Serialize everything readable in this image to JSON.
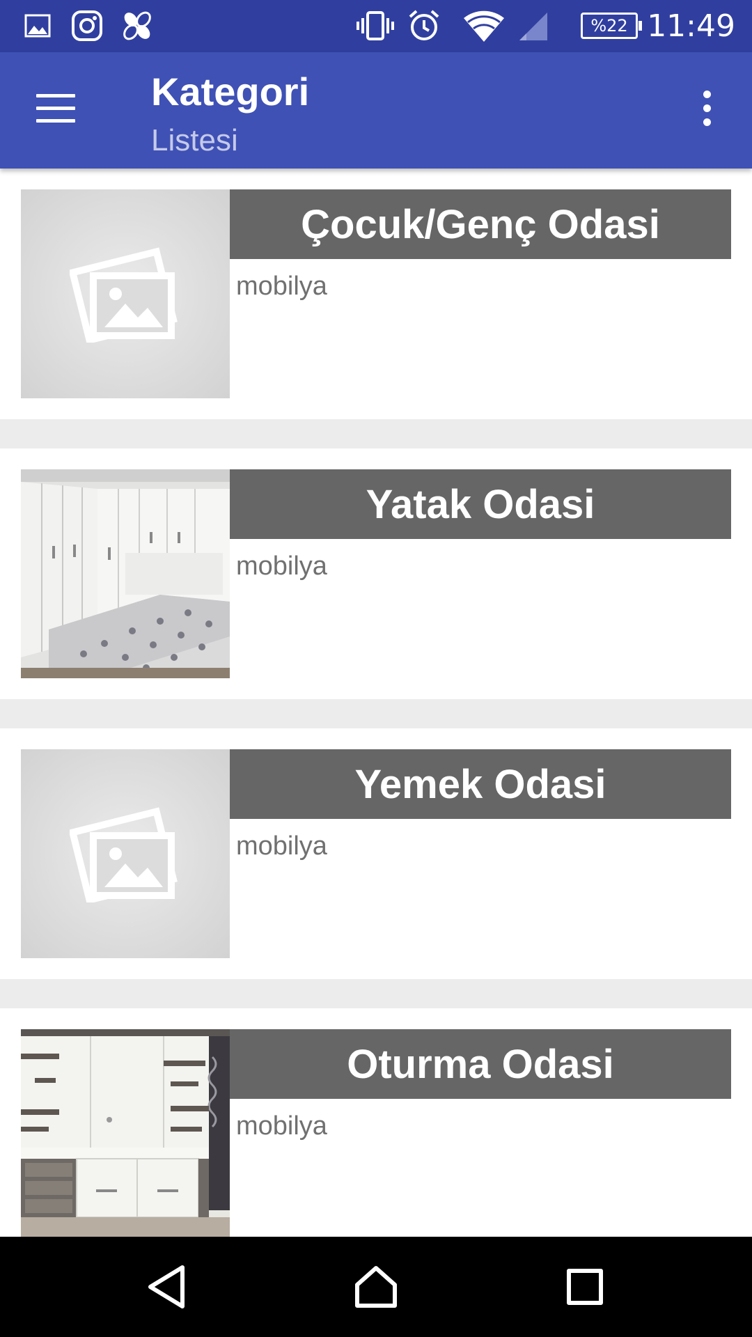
{
  "status_bar": {
    "time": "11:49",
    "battery": "%22",
    "icons": [
      "gallery-icon",
      "instagram-icon",
      "pinwheel-icon",
      "vibrate-icon",
      "alarm-icon",
      "wifi-icon",
      "cell-signal-icon",
      "battery-icon"
    ]
  },
  "app_bar": {
    "title": "Kategori",
    "subtitle": "Listesi",
    "menu_icon": "hamburger-icon",
    "overflow_icon": "more-vert-icon",
    "background": "#3f51b5",
    "status_background": "#303f9f"
  },
  "categories": [
    {
      "title": "Çocuk/Genç Odasi",
      "subtitle": "mobilya",
      "image": "placeholder-image-icon"
    },
    {
      "title": "Yatak Odasi",
      "subtitle": "mobilya",
      "image": "bedroom-photo"
    },
    {
      "title": "Yemek Odasi",
      "subtitle": "mobilya",
      "image": "placeholder-image-icon"
    },
    {
      "title": "Oturma Odasi",
      "subtitle": "mobilya",
      "image": "living-room-photo"
    }
  ],
  "nav_bar": {
    "icons": [
      "back-icon",
      "home-icon",
      "recents-icon"
    ]
  }
}
